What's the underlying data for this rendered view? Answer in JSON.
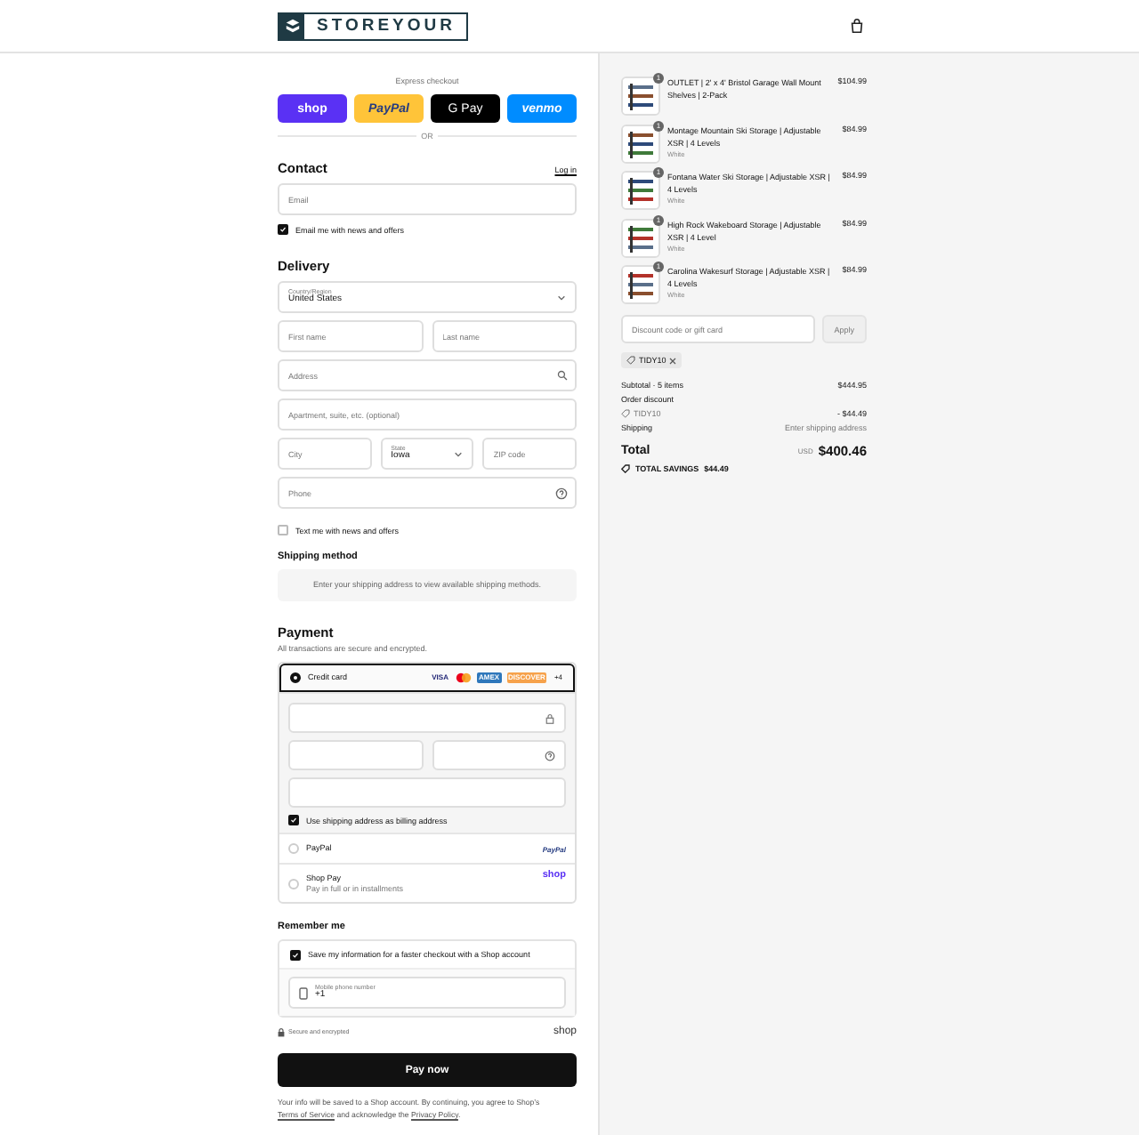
{
  "header": {
    "logo": "STOREYOUR"
  },
  "express": {
    "label": "Express checkout",
    "or": "OR",
    "buttons": [
      {
        "kind": "shop",
        "label": "shop"
      },
      {
        "kind": "paypal",
        "label": "PayPal"
      },
      {
        "kind": "gpay",
        "label": "G Pay"
      },
      {
        "kind": "venmo",
        "label": "venmo"
      }
    ]
  },
  "contact": {
    "title": "Contact",
    "login": "Log in",
    "email": {
      "placeholder": "Email"
    },
    "newsletter": {
      "label": "Email me with news and offers",
      "checked": true
    }
  },
  "delivery": {
    "title": "Delivery",
    "rows": [
      [
        {
          "kind": "select",
          "label": "Country/Region",
          "value": "United States"
        }
      ],
      [
        {
          "kind": "text",
          "placeholder": "First name"
        },
        {
          "kind": "text",
          "placeholder": "Last name"
        }
      ],
      [
        {
          "kind": "search",
          "placeholder": "Address"
        }
      ],
      [
        {
          "kind": "text",
          "placeholder": "Apartment, suite, etc. (optional)"
        }
      ],
      [
        {
          "kind": "text",
          "placeholder": "City"
        },
        {
          "kind": "select",
          "label": "State",
          "value": "Iowa"
        },
        {
          "kind": "text",
          "placeholder": "ZIP code"
        }
      ],
      [
        {
          "kind": "help",
          "placeholder": "Phone"
        }
      ]
    ],
    "sms": {
      "label": "Text me with news and offers",
      "checked": false
    }
  },
  "shipping": {
    "title": "Shipping method",
    "notice": "Enter your shipping address to view available shipping methods."
  },
  "payment": {
    "title": "Payment",
    "subtitle": "All transactions are secure and encrypted.",
    "methods": [
      {
        "kind": "card",
        "label": "Credit card",
        "selected": true,
        "brands": [
          {
            "kind": "visa",
            "label": "VISA"
          },
          {
            "kind": "mastercard"
          },
          {
            "kind": "amex",
            "label": "AMEX"
          },
          {
            "kind": "discover",
            "label": "DISCOVER"
          },
          {
            "kind": "more",
            "label": "+4"
          }
        ],
        "billing": {
          "label": "Use shipping address as billing address",
          "checked": true
        }
      },
      {
        "kind": "paypal",
        "label": "PayPal",
        "selected": false,
        "logo": "PayPal"
      },
      {
        "kind": "shop",
        "label": "Shop Pay",
        "note": "Pay in full or in installments",
        "selected": false,
        "logo": "shop"
      }
    ]
  },
  "remember": {
    "title": "Remember me",
    "save": {
      "label": "Save my information for a faster checkout with a Shop account",
      "checked": true
    },
    "phone": {
      "label": "Mobile phone number",
      "value": "+1"
    },
    "secure": "Secure and encrypted",
    "logo": "shop"
  },
  "pay_button": "Pay now",
  "legal": {
    "before": "Your info will be saved to a Shop account. By continuing, you agree to Shop’s",
    "terms": "Terms of Service",
    "middle": "and acknowledge the",
    "privacy": "Privacy Policy",
    "after": "."
  },
  "cart": {
    "items": [
      {
        "name": "OUTLET | 2' x 4' Bristol Garage Wall Mount Shelves | 2-Pack",
        "qty": "1",
        "price": "$104.99"
      },
      {
        "name": "Montage Mountain Ski Storage | Adjustable XSR | 4 Levels",
        "variant": "White",
        "qty": "1",
        "price": "$84.99"
      },
      {
        "name": "Fontana Water Ski Storage | Adjustable XSR | 4 Levels",
        "variant": "White",
        "qty": "1",
        "price": "$84.99"
      },
      {
        "name": "High Rock Wakeboard Storage | Adjustable XSR | 4 Level",
        "variant": "White",
        "qty": "1",
        "price": "$84.99"
      },
      {
        "name": "Carolina Wakesurf Storage | Adjustable XSR | 4 Levels",
        "variant": "White",
        "qty": "1",
        "price": "$84.99"
      }
    ],
    "discount": {
      "placeholder": "Discount code or gift card",
      "button": "Apply",
      "tag": "TIDY10"
    },
    "subtotal": {
      "label": "Subtotal · 5 items",
      "value": "$444.95"
    },
    "order_discount": {
      "label": "Order discount",
      "code": "TIDY10",
      "value": "- $44.49"
    },
    "shipping": {
      "label": "Shipping",
      "value": "Enter shipping address"
    },
    "total": {
      "label": "Total",
      "currency": "USD",
      "value": "$400.46"
    },
    "savings": {
      "label": "TOTAL SAVINGS",
      "value": "$44.49"
    }
  }
}
